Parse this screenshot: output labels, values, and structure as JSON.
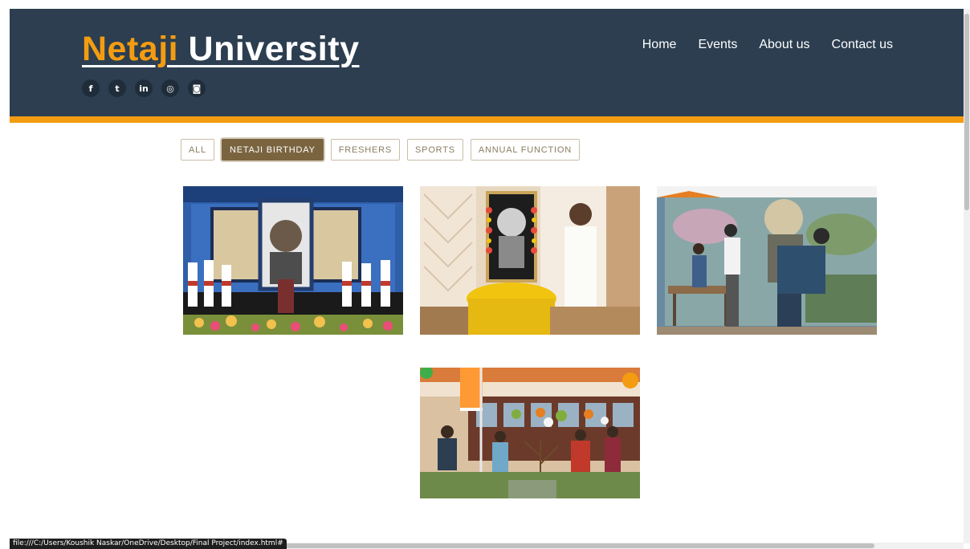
{
  "brand": {
    "part1": "Netaji",
    "part2": " University"
  },
  "social": [
    {
      "icon": "facebook-icon",
      "glyph": "f"
    },
    {
      "icon": "twitter-icon",
      "glyph": "t"
    },
    {
      "icon": "linkedin-icon",
      "glyph": "in"
    },
    {
      "icon": "whatsapp-icon",
      "glyph": "◎"
    },
    {
      "icon": "instagram-icon",
      "glyph": "◙"
    }
  ],
  "nav": {
    "home": "Home",
    "events": "Events",
    "about": "About us",
    "contact": "Contact us"
  },
  "filters": {
    "all": "ALL",
    "birthday": "NETAJI BIRTHDAY",
    "freshers": "FRESHERS",
    "sports": "SPORTS",
    "annual": "ANNUAL FUNCTION",
    "active": "NETAJI BIRTHDAY"
  },
  "status_url": "file:///C:/Users/Koushik Naskar/OneDrive/Desktop/Final Project/index.html#",
  "colors": {
    "header": "#2c3e50",
    "accent": "#f39c12",
    "active_filter": "#7a6440"
  }
}
